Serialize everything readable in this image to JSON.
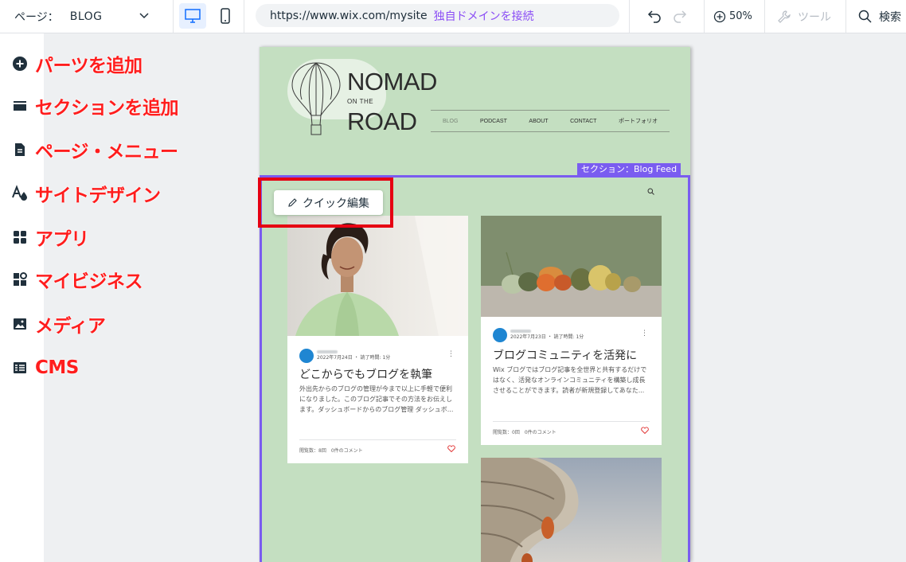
{
  "topbar": {
    "page_label": "ページ：",
    "page_value": "BLOG",
    "url": "https://www.wix.com/mysite",
    "connect_domain": "独自ドメインを接続",
    "zoom": "50%",
    "tools": "ツール",
    "search": "検索"
  },
  "sidebar": {
    "items": [
      {
        "label": "パーツを追加",
        "icon": "plus-circle-icon"
      },
      {
        "label": "セクションを追加",
        "icon": "section-icon"
      },
      {
        "label": "ページ・メニュー",
        "icon": "page-icon"
      },
      {
        "label": "サイトデザイン",
        "icon": "design-icon"
      },
      {
        "label": "アプリ",
        "icon": "apps-icon"
      },
      {
        "label": "マイビジネス",
        "icon": "business-icon"
      },
      {
        "label": "メディア",
        "icon": "media-icon"
      },
      {
        "label": "CMS",
        "icon": "cms-icon"
      }
    ]
  },
  "site": {
    "logo": {
      "line1": "NOMAD",
      "line2": "ON THE",
      "line3": "ROAD"
    },
    "nav": [
      "BLOG",
      "PODCAST",
      "ABOUT",
      "CONTACT",
      "ポートフォリオ"
    ],
    "section_tag": "セクション：Blog Feed",
    "quick_edit": "クイック編集",
    "posts": [
      {
        "date": "2022年7月24日 ・ 読了時間: 1分",
        "title": "どこからでもブログを執筆",
        "excerpt": "外出先からのブログの管理が今まで以上に手軽で便利になりました。このブログ記事でその方法をお伝えします。ダッシュボードからのブログ管理 ダッシュボ...",
        "stats": "閲覧数：8回　0件のコメント"
      },
      {
        "date": "2022年7月23日 ・ 読了時間: 1分",
        "title": "ブログコミュニティを活発に",
        "excerpt": "Wix ブログではブログ記事を全世界と共有するだけではなく、活発なオンラインコミュニティを構築し成長させることができます。読者が新規登録してあなた...",
        "stats": "閲覧数：0回　0件のコメント"
      }
    ]
  },
  "colors": {
    "accent": "#8a4cf5",
    "section_frame": "#7a5cf0",
    "highlight": "#e60012",
    "annotation_text": "#ff1d1d",
    "site_bg": "#c4dfc1"
  }
}
